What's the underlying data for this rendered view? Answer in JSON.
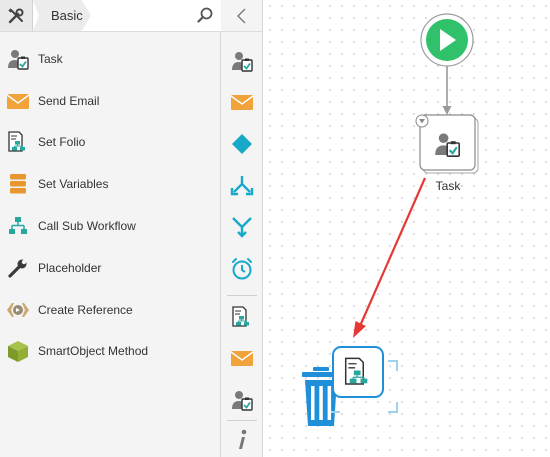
{
  "header": {
    "breadcrumb": "Basic",
    "tools_icon": "tools-icon",
    "search_icon": "search-icon"
  },
  "sidebar": {
    "items": [
      {
        "label": "Task",
        "icon": "task-icon"
      },
      {
        "label": "Send Email",
        "icon": "email-icon"
      },
      {
        "label": "Set Folio",
        "icon": "folio-icon"
      },
      {
        "label": "Set Variables",
        "icon": "variables-icon"
      },
      {
        "label": "Call Sub Workflow",
        "icon": "sub-workflow-icon"
      },
      {
        "label": "Placeholder",
        "icon": "wrench-icon"
      },
      {
        "label": "Create Reference",
        "icon": "reference-icon"
      },
      {
        "label": "SmartObject Method",
        "icon": "smartobject-icon"
      }
    ]
  },
  "strip": {
    "icons": [
      "task-icon",
      "email-icon",
      "decision-icon",
      "split-icon",
      "merge-icon",
      "timer-icon",
      "folio-icon",
      "email-icon",
      "task-icon",
      "info-icon"
    ]
  },
  "canvas": {
    "task_label": "Task",
    "colors": {
      "start": "#2fc26a",
      "arrow": "#e53935",
      "trash": "#1e8fd8",
      "teal": "#2aa6a0",
      "orange": "#f0a33a"
    }
  }
}
